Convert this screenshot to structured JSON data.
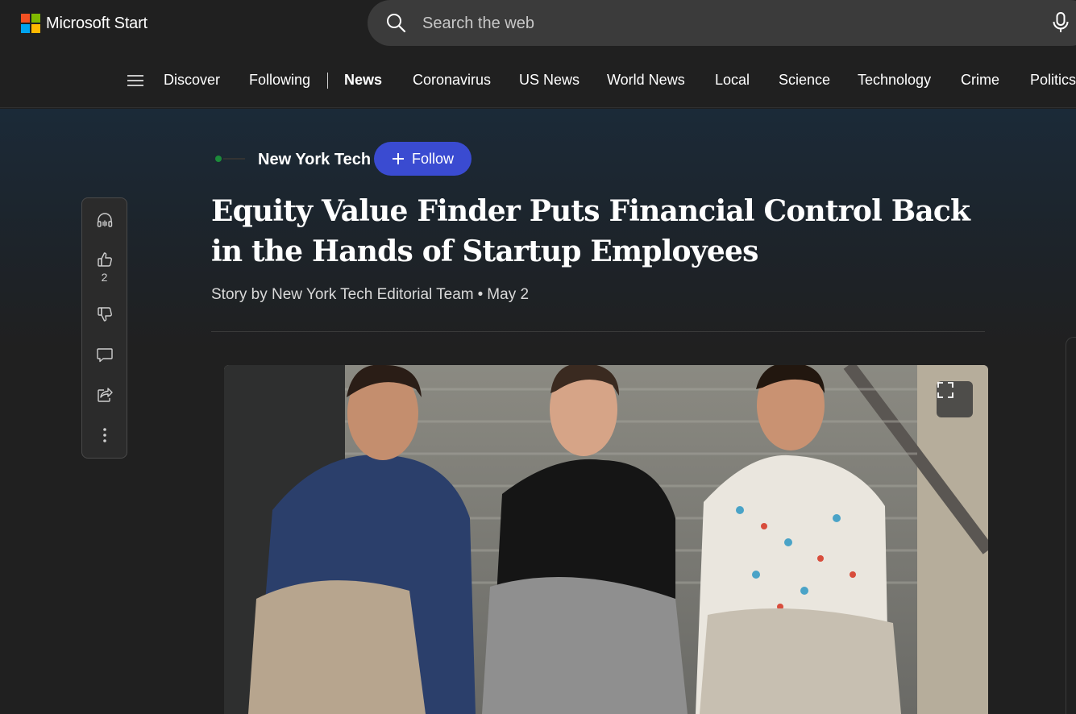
{
  "header": {
    "brand": "Microsoft Start",
    "logo_colors": [
      "#f25022",
      "#7fba00",
      "#00a4ef",
      "#ffb900"
    ],
    "search": {
      "placeholder": "Search the web",
      "icon": "search-icon"
    },
    "mic_icon": "microphone-icon"
  },
  "nav": {
    "menu_icon": "hamburger-icon",
    "items": [
      {
        "label": "Discover"
      },
      {
        "label": "Following"
      },
      {
        "label": "News"
      },
      {
        "label": "Coronavirus"
      },
      {
        "label": "US News"
      },
      {
        "label": "World News"
      },
      {
        "label": "Local"
      },
      {
        "label": "Science"
      },
      {
        "label": "Technology"
      },
      {
        "label": "Crime"
      },
      {
        "label": "Politics"
      }
    ],
    "active": "News"
  },
  "article": {
    "publisher": "New York Tech",
    "follow_label": "Follow",
    "title": "Equity Value Finder Puts Financial Control Back in the Hands of Startup Employees",
    "byline": "Story by New York Tech Editorial Team",
    "date": "May 2",
    "accent": "#3a4bd1"
  },
  "rail": {
    "buttons": [
      {
        "icon": "headphones-icon"
      },
      {
        "icon": "thumbs-up-icon",
        "count": "2"
      },
      {
        "icon": "thumbs-down-icon"
      },
      {
        "icon": "comment-icon"
      },
      {
        "icon": "share-icon"
      },
      {
        "icon": "more-options-icon"
      }
    ]
  },
  "image": {
    "expand_icon": "fullscreen-icon"
  }
}
